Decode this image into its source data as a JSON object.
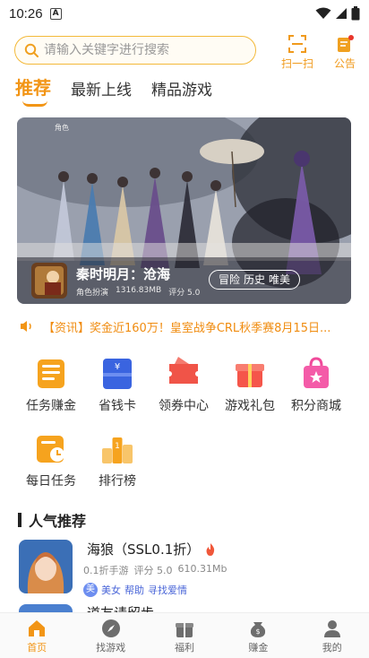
{
  "status_bar": {
    "time": "10:26",
    "notif_glyph": "A"
  },
  "header": {
    "search_placeholder": "请输入关键字进行搜索",
    "scan_label": "扫一扫",
    "notice_label": "公告",
    "accent_color": "#f29516"
  },
  "tabs": [
    {
      "label": "推荐",
      "active": true
    },
    {
      "label": "最新上线",
      "active": false
    },
    {
      "label": "精品游戏",
      "active": false
    }
  ],
  "banner": {
    "title": "秦时明月：沧海",
    "category": "角色扮演",
    "size": "1316.83MB",
    "rating": "评分 5.0",
    "tags": [
      "冒险",
      "历史",
      "唯美"
    ],
    "corner_text": "角色"
  },
  "marquee": {
    "text": "【资讯】奖金近160万！皇室战争CRL秋季赛8月15日..."
  },
  "features": [
    {
      "label": "任务赚金",
      "icon": "clipboard-icon"
    },
    {
      "label": "省钱卡",
      "icon": "savings-card-icon"
    },
    {
      "label": "领券中心",
      "icon": "coupon-icon"
    },
    {
      "label": "游戏礼包",
      "icon": "gift-box-icon"
    },
    {
      "label": "积分商城",
      "icon": "shopping-bag-icon"
    },
    {
      "label": "每日任务",
      "icon": "calendar-clock-icon"
    },
    {
      "label": "排行榜",
      "icon": "podium-icon"
    }
  ],
  "section": {
    "title": "人气推荐"
  },
  "games": [
    {
      "name": "海狼（SSL0.1折）",
      "meta": [
        "0.1折手游",
        "评分 5.0",
        "610.31Mb"
      ],
      "badge": "美",
      "tags": [
        "美女",
        "帮助",
        "寻找爱情"
      ]
    },
    {
      "name": "道友请留步",
      "meta": [],
      "badge": "",
      "tags": []
    }
  ],
  "bottom_nav": [
    {
      "label": "首页",
      "active": true,
      "icon": "home-icon"
    },
    {
      "label": "找游戏",
      "active": false,
      "icon": "compass-icon"
    },
    {
      "label": "福利",
      "active": false,
      "icon": "gift-icon"
    },
    {
      "label": "赚金",
      "active": false,
      "icon": "coin-icon"
    },
    {
      "label": "我的",
      "active": false,
      "icon": "user-icon"
    }
  ]
}
